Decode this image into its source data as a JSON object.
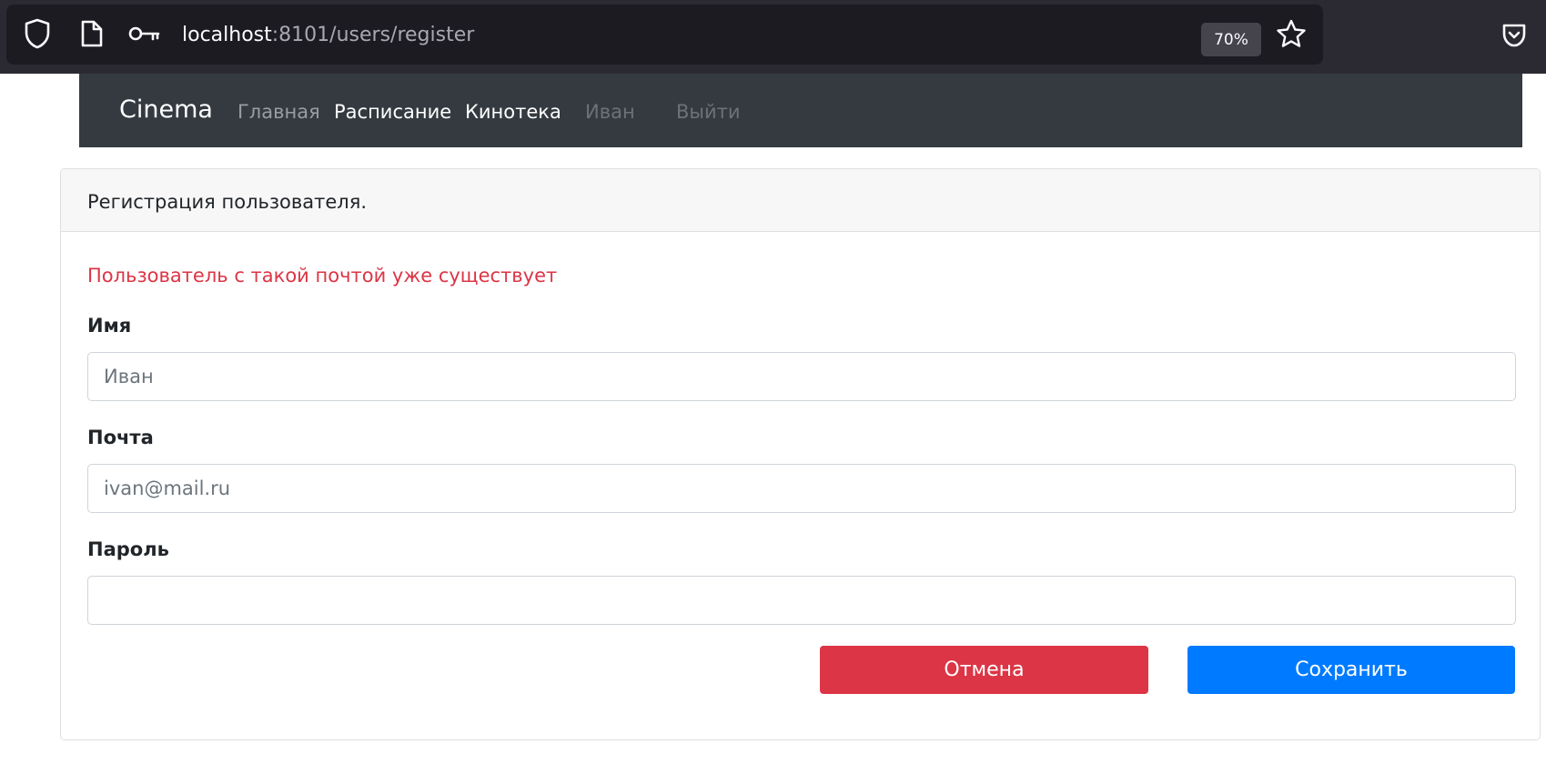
{
  "browser": {
    "url_host": "localhost",
    "url_rest": ":8101/users/register",
    "zoom": "70%",
    "icons": [
      "shield-icon",
      "page-icon",
      "key-icon",
      "star-icon",
      "pocket-icon"
    ]
  },
  "navbar": {
    "brand": "Cinema",
    "links": [
      "Главная",
      "Расписание",
      "Кинотека",
      "Иван",
      "Выйти"
    ]
  },
  "card": {
    "title": "Регистрация пользователя.",
    "error": "Пользователь с такой почтой уже существует",
    "fields": [
      {
        "label": "Имя",
        "placeholder": "Иван"
      },
      {
        "label": "Почта",
        "placeholder": "ivan@mail.ru"
      },
      {
        "label": "Пароль",
        "placeholder": ""
      }
    ],
    "cancel_label": "Отмена",
    "save_label": "Сохранить"
  },
  "colors": {
    "navbar_bg": "#343a40",
    "danger": "#dc3545",
    "primary": "#007bff"
  }
}
